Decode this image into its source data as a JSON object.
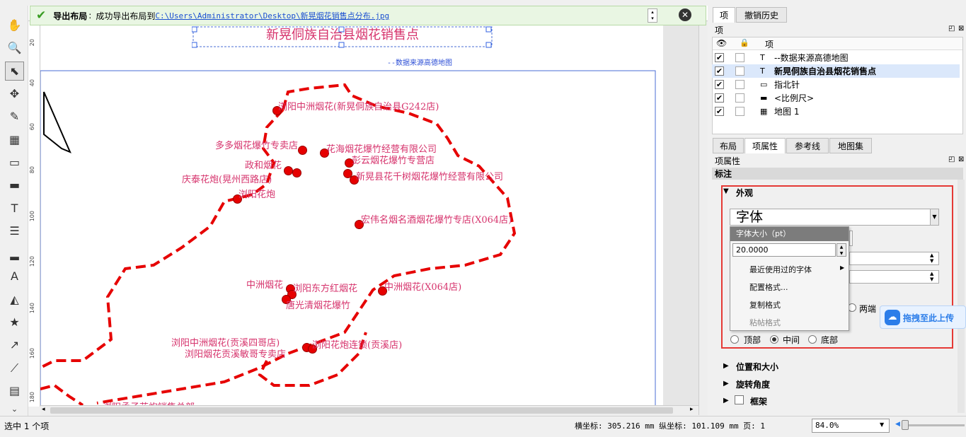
{
  "message": {
    "title": "导出布局",
    "text": "成功导出布局到",
    "link": "C:\\Users\\Administrator\\Desktop\\新晃烟花销售点分布.jpg"
  },
  "map": {
    "title": "新晃侗族自治县烟花销售点",
    "source": "--数据来源高德地图",
    "stores": [
      "浏阳中洲烟花(新晃侗族自治县G242店)",
      "多多烟花爆竹专卖店",
      "花海烟花爆竹经营有限公司",
      "政和烟花",
      "彭云烟花爆竹专营店",
      "庆泰花炮(晃州西路店)",
      "新晃县花千树烟花爆竹经营有限公司",
      "浏阳花炮",
      "宏伟名烟名酒烟花爆竹专店(X064店)",
      "中洲烟花",
      "浏阳东方红烟花",
      "中洲烟花(X064店)",
      "唐光清烟花爆竹",
      "浏阳中洲烟花(贡溪四哥店)",
      "浏阳花炮连锁(贡溪店)",
      "浏阳烟花贡溪敏哥专卖店",
      "浏阳孟子花炮销售总部"
    ]
  },
  "ruler_labels": [
    "20",
    "40",
    "60",
    "80",
    "100",
    "120",
    "140",
    "160",
    "180"
  ],
  "panel": {
    "tabs_top": [
      "项",
      "撤销历史"
    ],
    "items_title": "项",
    "col_item": "项",
    "layers": [
      {
        "label": "--数据来源高德地图",
        "icon": "text-icon",
        "bold": false
      },
      {
        "label": "新晃侗族自治县烟花销售点",
        "icon": "text-icon",
        "bold": true
      },
      {
        "label": "指北针",
        "icon": "picture-icon",
        "bold": false
      },
      {
        "label": "<比例尺>",
        "icon": "scalebar-icon",
        "bold": false
      },
      {
        "label": "地图 1",
        "icon": "map-icon",
        "bold": false
      }
    ],
    "tabs_mid": [
      "布局",
      "项属性",
      "参考线",
      "地图集"
    ],
    "props_title": "项属性",
    "section_label": "标注",
    "appearance": "外观",
    "font_button": "字体",
    "popup_header": "字体大小（pt）",
    "font_size": "20.0000",
    "menu_items": [
      "最近使用过的字体",
      "配置格式...",
      "复制格式",
      "粘帖格式"
    ],
    "justify": "两端",
    "valign": [
      "顶部",
      "中间",
      "底部"
    ],
    "sections": [
      "位置和大小",
      "旋转角度",
      "框架"
    ],
    "upload_badge": "拖拽至此上传"
  },
  "status": {
    "selection": "选中 1 个项",
    "coords": "横坐标: 305.216 mm 纵坐标: 101.109 mm 页: 1",
    "zoom": "84.0%"
  },
  "colors": {
    "accent": "#e60000",
    "label": "#d6336c",
    "panel_border": "#e53935"
  }
}
